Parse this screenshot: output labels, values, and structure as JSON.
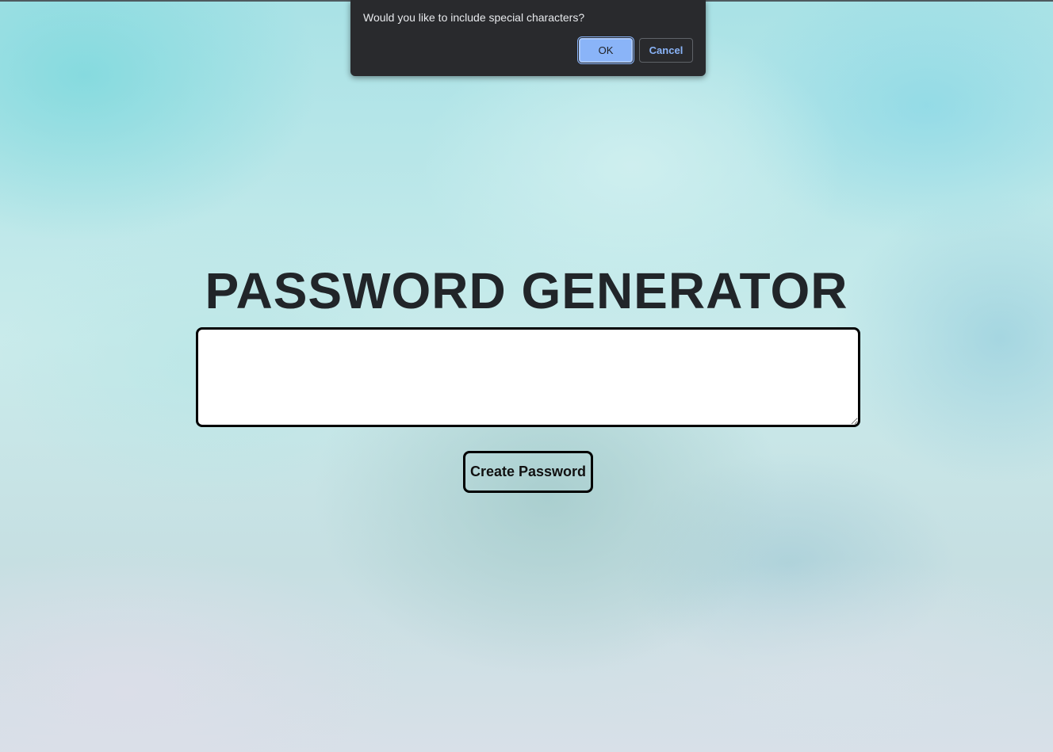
{
  "dialog": {
    "message": "Would you like to include special characters?",
    "ok_label": "OK",
    "cancel_label": "Cancel"
  },
  "main": {
    "title": "PASSWORD GENERATOR",
    "password_value": "",
    "create_button_label": "Create Password"
  },
  "colors": {
    "dialog_background": "#292a2d",
    "dialog_accent": "#8ab4f8",
    "title_text": "#212529",
    "border": "#000000"
  }
}
